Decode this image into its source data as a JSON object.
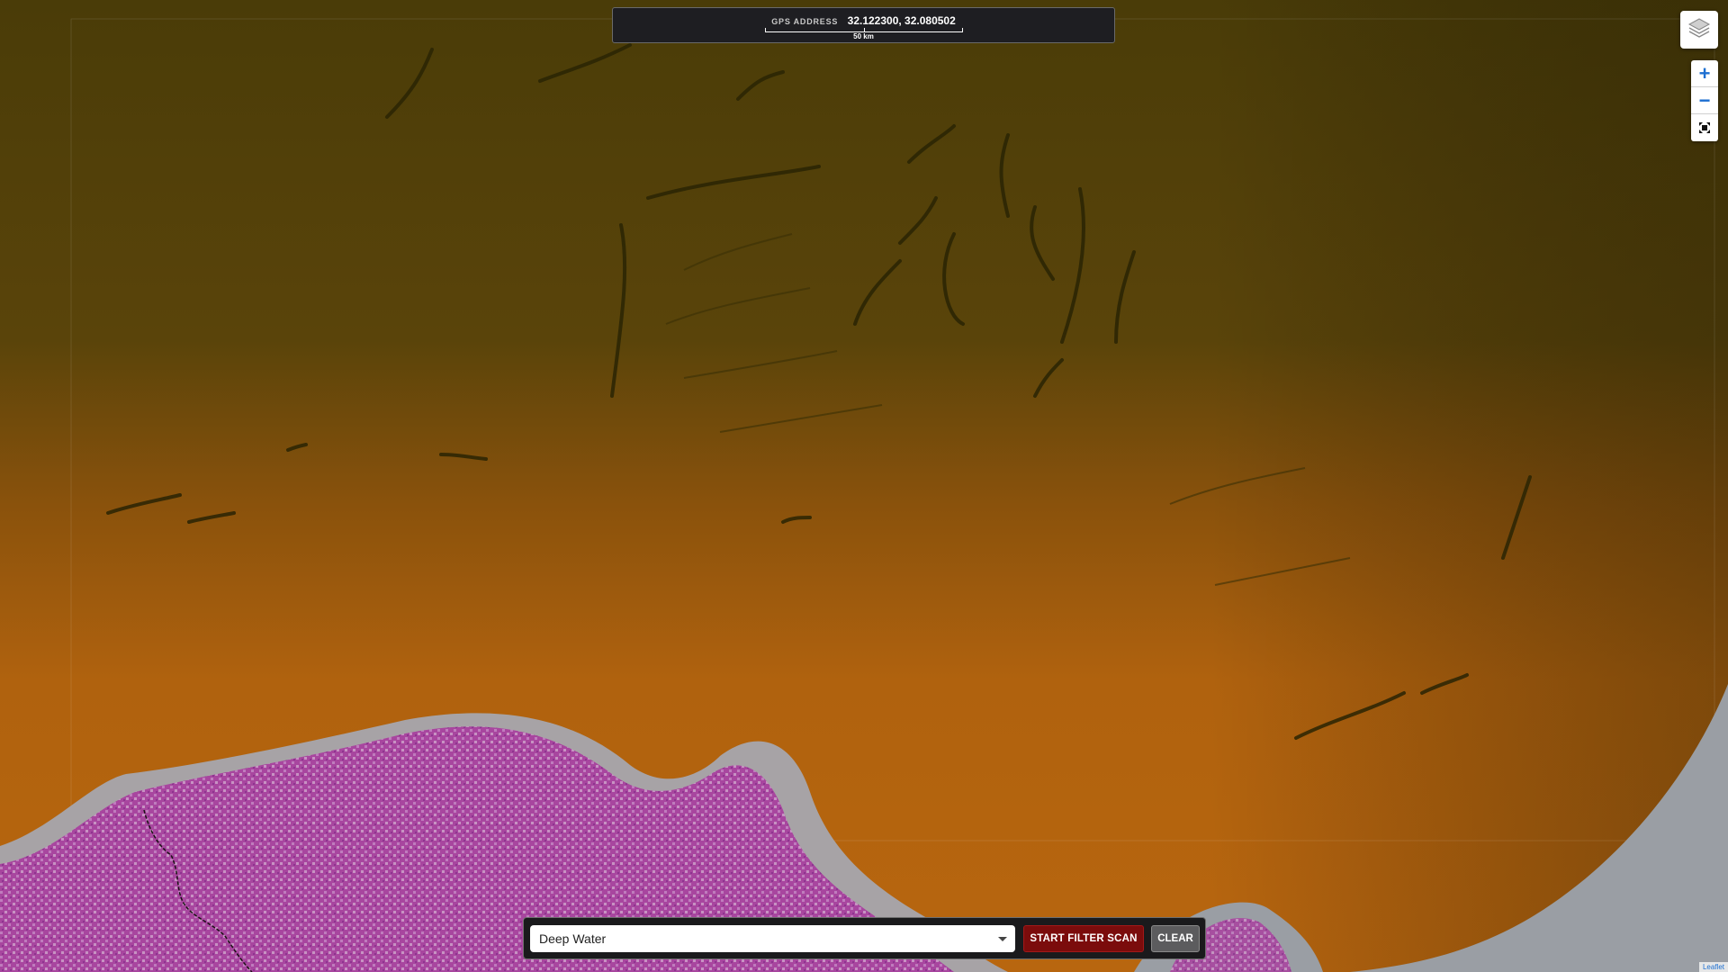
{
  "gps": {
    "label": "GPS ADDRESS",
    "coordinates": "32.122300, 32.080502",
    "scale_label": "50 km"
  },
  "controls": {
    "layers_icon": "layers-icon",
    "zoom_in_label": "+",
    "zoom_out_label": "−",
    "fullscreen_icon": "fullscreen-icon"
  },
  "filter": {
    "selected_option": "Deep Water",
    "scan_label": "START FILTER SCAN",
    "clear_label": "CLEAR"
  },
  "attribution": "Leaflet",
  "colors": {
    "land_top": "#4a3c08",
    "land_mid": "#7a4c0a",
    "land_bottom": "#b4640e",
    "vegetation": "#a04aa8",
    "water": "#9aa0a6",
    "scan_button": "#7b0c0c"
  }
}
